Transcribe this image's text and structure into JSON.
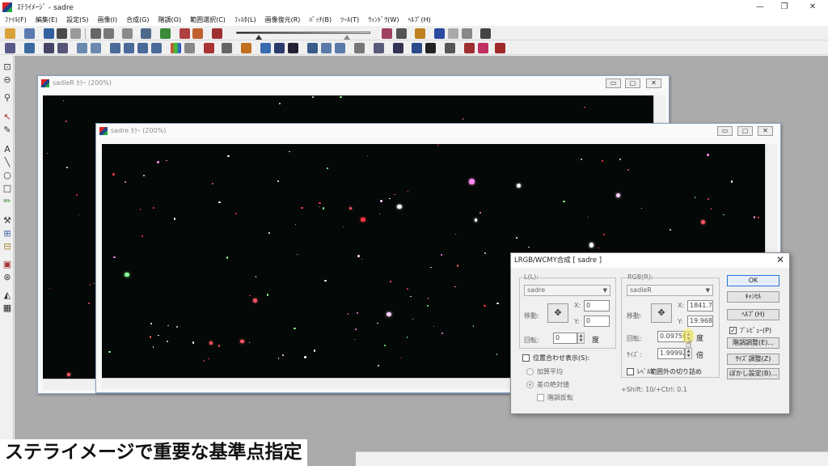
{
  "app": {
    "title": "ｽﾃﾗｲﾒｰｼﾞ - sadre",
    "win_buttons": [
      "—",
      "❐",
      "✕"
    ]
  },
  "menu": [
    "ﾌｧｲﾙ(F)",
    "編集(E)",
    "設定(S)",
    "画像(I)",
    "合成(G)",
    "階調(O)",
    "範囲選択(C)",
    "ﾌｨﾙﾀ(L)",
    "画像復元(R)",
    "ﾊﾞｯﾁ(B)",
    "ﾂｰﾙ(T)",
    "ｳｨﾝﾄﾞｳ(W)",
    "ﾍﾙﾌﾟ(H)"
  ],
  "windows": {
    "back": {
      "title": "sadleR ｶﾗｰ (200%)"
    },
    "front": {
      "title": "sadre ｶﾗｰ (200%)"
    }
  },
  "dialog": {
    "title": "LRGB/WCMY合成 [ sadre ]",
    "left_group": {
      "label": "L(L):",
      "source": "sadre",
      "move_label": "移動:",
      "x_label": "X:",
      "x_value": "0",
      "y_label": "Y:",
      "y_value": "0",
      "rotate_label": "回転:",
      "rotate_value": "0",
      "deg_unit": "度"
    },
    "right_group": {
      "label": "RGB(R):",
      "source": "sadleR",
      "move_label": "移動:",
      "x_label": "X:",
      "x_value": "1841.7",
      "y_label": "Y:",
      "y_value": "19.9685",
      "rotate_label": "回転:",
      "rotate_value": "0.09756",
      "deg_unit": "度",
      "size_label": "ｻｲｽﾞ:",
      "size_value": "1.99992",
      "size_unit": "倍",
      "level_clip_label": "ﾚﾍﾞﾙ範囲外の切り詰め"
    },
    "align_display_label": "位置合わせ表示(S):",
    "radio_add_avg": "加算平均",
    "radio_abs_diff": "差の絶対値",
    "invert_label": "階調反転",
    "hint": "+Shift: 10/+Ctrl: 0.1",
    "buttons": {
      "ok": "OK",
      "cancel": "ｷｬﾝｾﾙ",
      "help": "ﾍﾙﾌﾟ(H)",
      "preview": "ﾌﾟﾚﾋﾞｭｰ(P)",
      "tone": "階調調整(E)...",
      "size_adjust": "ｻｲｽﾞ調整(Z)",
      "blur": "ぼかし設定(B)..."
    }
  },
  "caption": "ステライメージで重要な基準点指定",
  "colors": {
    "canvas_bg": "#040806",
    "accent": "#2b74d1"
  }
}
